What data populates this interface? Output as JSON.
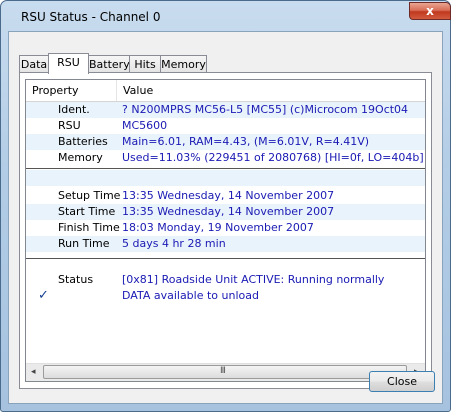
{
  "window": {
    "title": "RSU Status - Channel 0",
    "close_glyph": "x"
  },
  "tabs": [
    "Data",
    "RSU",
    "Battery",
    "Hits",
    "Memory"
  ],
  "active_tab": "RSU",
  "list": {
    "columns": [
      "Property",
      "Value"
    ],
    "rows": [
      {
        "property": "Ident.",
        "value": "? N200MPRS MC56-L5 [MC55] (c)Microcom 19Oct04"
      },
      {
        "property": "RSU",
        "value": "MC5600"
      },
      {
        "property": "Batteries",
        "value": "Main=6.01, RAM=4.43, (M=6.01V, R=4.41V)"
      },
      {
        "property": "Memory",
        "value": "Used=11.03% (229451 of 2080768) [HI=0f, LO=404b]"
      },
      {
        "property": "",
        "value": ""
      },
      {
        "property": "Setup Time",
        "value": "13:35 Wednesday, 14 November 2007"
      },
      {
        "property": "Start Time",
        "value": "13:35 Wednesday, 14 November 2007"
      },
      {
        "property": "Finish Time",
        "value": "18:03 Monday, 19 November 2007"
      },
      {
        "property": "Run Time",
        "value": "5 days 4 hr 28 min"
      },
      {
        "property": "Status",
        "value": "[0x81] Roadside Unit ACTIVE: Running normally"
      },
      {
        "property": "",
        "value": "DATA available to unload"
      }
    ],
    "check_glyph": "✓"
  },
  "scrollbar": {
    "left_arrow": "◂",
    "right_arrow": "▸",
    "grip": "III"
  },
  "buttons": {
    "close_label": "Close"
  }
}
